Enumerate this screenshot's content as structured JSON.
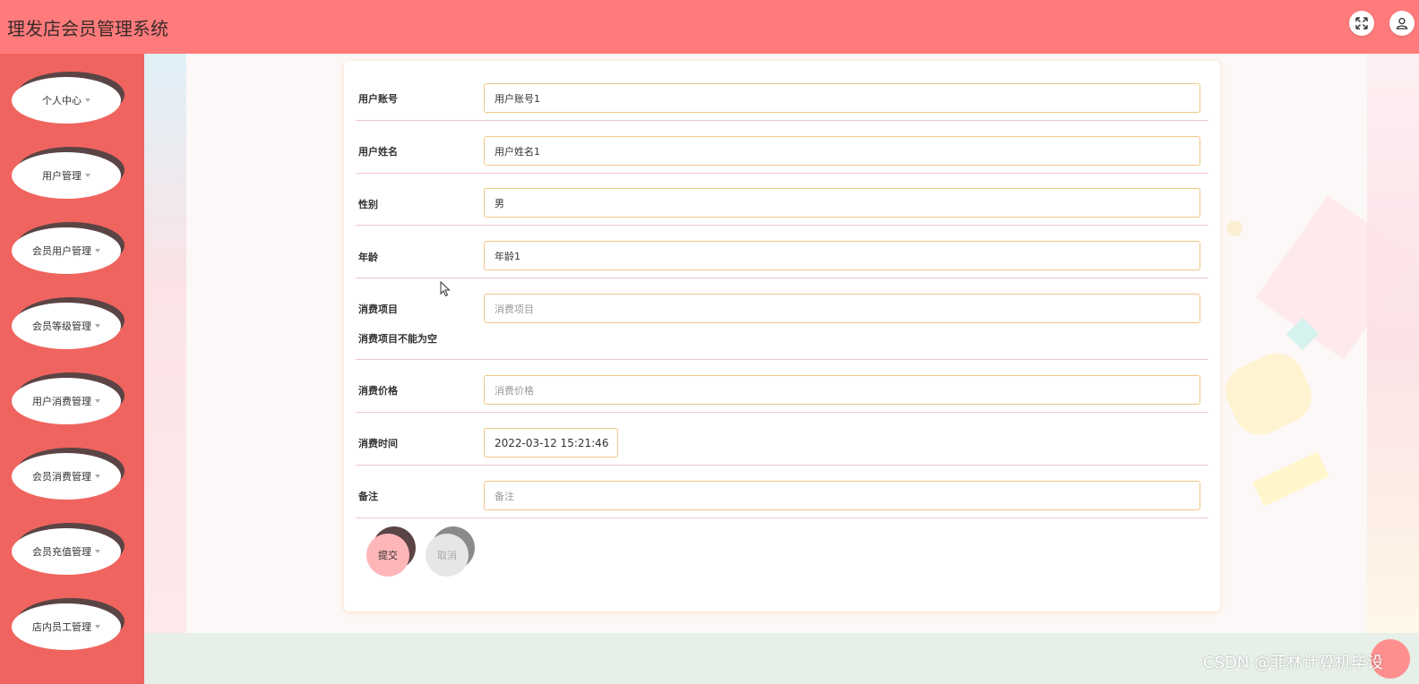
{
  "header": {
    "title": "理发店会员管理系统",
    "fullscreen_icon": "expand-arrows-icon",
    "user_icon": "user-icon"
  },
  "sidebar": {
    "items": [
      {
        "label": "个人中心"
      },
      {
        "label": "用户管理"
      },
      {
        "label": "会员用户管理"
      },
      {
        "label": "会员等级管理"
      },
      {
        "label": "用户消费管理"
      },
      {
        "label": "会员消费管理"
      },
      {
        "label": "会员充值管理"
      },
      {
        "label": "店内员工管理"
      }
    ]
  },
  "form": {
    "account": {
      "label": "用户账号",
      "value": "用户账号1"
    },
    "name": {
      "label": "用户姓名",
      "value": "用户姓名1"
    },
    "gender": {
      "label": "性别",
      "value": "男"
    },
    "age": {
      "label": "年龄",
      "value": "年龄1"
    },
    "item": {
      "label": "消费项目",
      "placeholder": "消费项目",
      "error": "消费项目不能为空"
    },
    "price": {
      "label": "消费价格",
      "placeholder": "消费价格"
    },
    "time": {
      "label": "消费时间",
      "value": "2022-03-12 15:21:46"
    },
    "remark": {
      "label": "备注",
      "placeholder": "备注"
    },
    "submit_label": "提交",
    "cancel_label": "取消"
  },
  "watermark": "CSDN @菲林计算机毕设",
  "colors": {
    "header": "#ff7b7b",
    "sidebar": "#f0645f",
    "input_border": "#f0c884",
    "submit": "#ffb6b9",
    "cancel": "#e6e6e6"
  }
}
